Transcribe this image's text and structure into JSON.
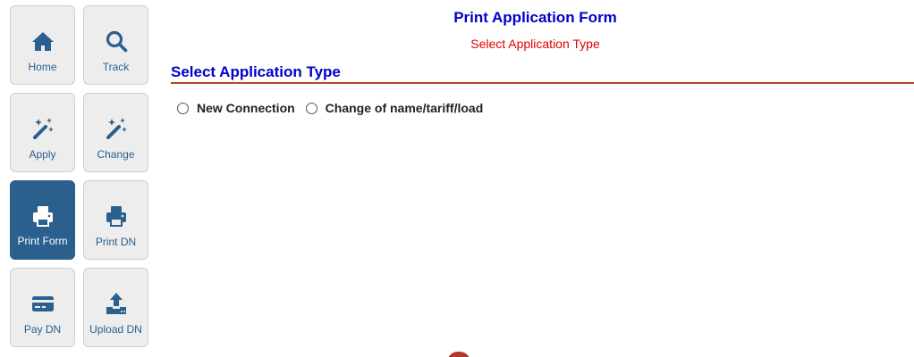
{
  "sidebar": {
    "active_color": "#2a5f8e",
    "items": [
      {
        "label": "Home",
        "icon": "home-icon"
      },
      {
        "label": "Track",
        "icon": "search-icon"
      },
      {
        "label": "Apply",
        "icon": "magic-wand-icon"
      },
      {
        "label": "Change",
        "icon": "magic-wand-icon"
      },
      {
        "label": "Print Form",
        "icon": "printer-icon",
        "active": true
      },
      {
        "label": "Print DN",
        "icon": "printer-icon"
      },
      {
        "label": "Pay DN",
        "icon": "credit-card-icon"
      },
      {
        "label": "Upload DN",
        "icon": "upload-icon"
      }
    ]
  },
  "main": {
    "title": "Print Application Form",
    "subtitle": "Select Application Type",
    "section_title": "Select Application Type",
    "title_color": "#0000cc",
    "subtitle_color": "#e00000",
    "rule_color": "#b5471b",
    "options": [
      {
        "label": "New Connection",
        "selected": false
      },
      {
        "label": "Change of name/tariff/load",
        "selected": false
      }
    ]
  }
}
